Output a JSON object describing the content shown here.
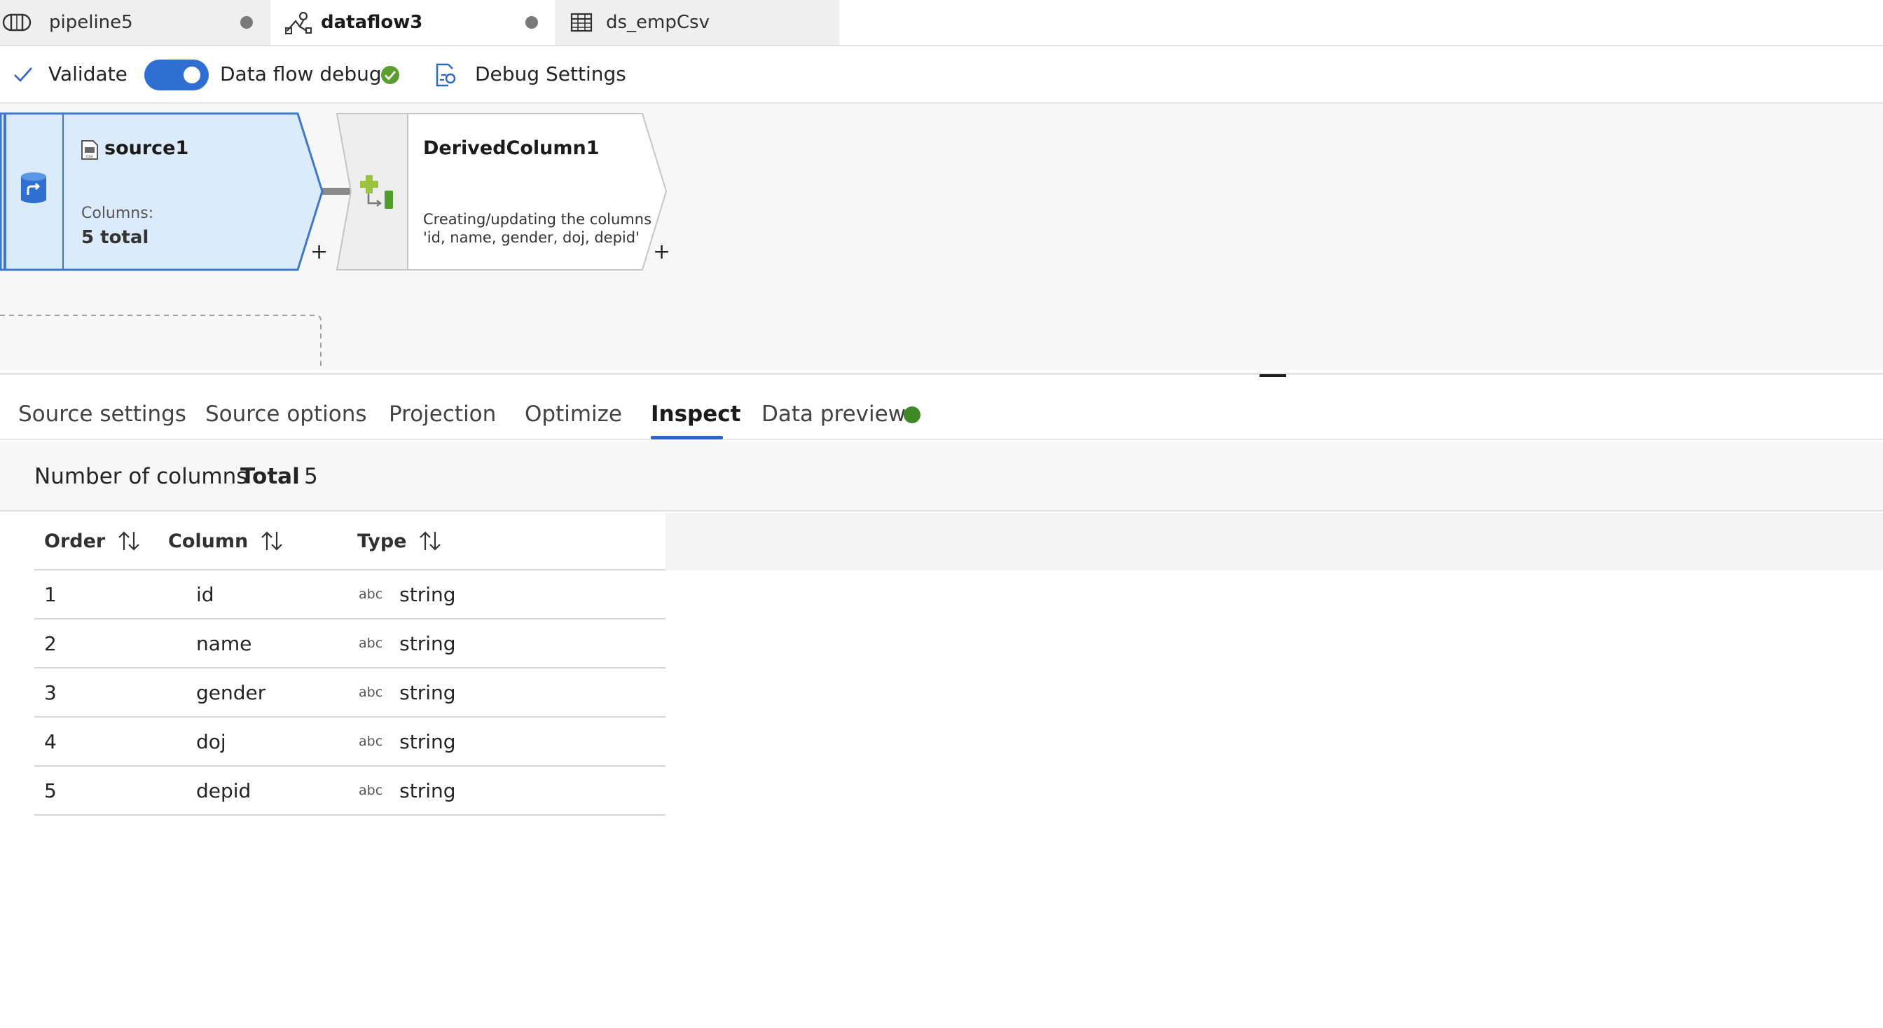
{
  "tabs": [
    {
      "label": "pipeline5",
      "icon": "pipeline-icon",
      "unsaved": true
    },
    {
      "label": "dataflow3",
      "icon": "dataflow-icon",
      "unsaved": true,
      "active": true
    },
    {
      "label": "ds_empCsv",
      "icon": "table-icon",
      "unsaved": false
    }
  ],
  "toolbar": {
    "validate_label": "Validate",
    "debug_label": "Data flow debug",
    "debug_on": true,
    "debug_settings_label": "Debug Settings"
  },
  "canvas": {
    "source": {
      "name": "source1",
      "columns_label": "Columns:",
      "columns_value": "5 total"
    },
    "derived": {
      "name": "DerivedColumn1",
      "desc_line1": "Creating/updating the columns",
      "desc_line2": "'id, name, gender, doj, depid'"
    },
    "add_symbol": "+"
  },
  "property_tabs": [
    {
      "label": "Source settings"
    },
    {
      "label": "Source options"
    },
    {
      "label": "Projection"
    },
    {
      "label": "Optimize"
    },
    {
      "label": "Inspect",
      "active": true
    },
    {
      "label": "Data preview"
    }
  ],
  "inspect": {
    "count_label": "Number of columns",
    "total_label": "Total",
    "total_value": "5",
    "headers": {
      "order": "Order",
      "column": "Column",
      "type": "Type"
    },
    "rows": [
      {
        "order": "1",
        "column": "id",
        "type_badge": "abc",
        "type": "string"
      },
      {
        "order": "2",
        "column": "name",
        "type_badge": "abc",
        "type": "string"
      },
      {
        "order": "3",
        "column": "gender",
        "type_badge": "abc",
        "type": "string"
      },
      {
        "order": "4",
        "column": "doj",
        "type_badge": "abc",
        "type": "string"
      },
      {
        "order": "5",
        "column": "depid",
        "type_badge": "abc",
        "type": "string"
      }
    ]
  },
  "colors": {
    "accent": "#2a63c9",
    "source_fill": "#dcebfb",
    "source_border": "#3f78c7",
    "status_green": "#3d8a25"
  }
}
